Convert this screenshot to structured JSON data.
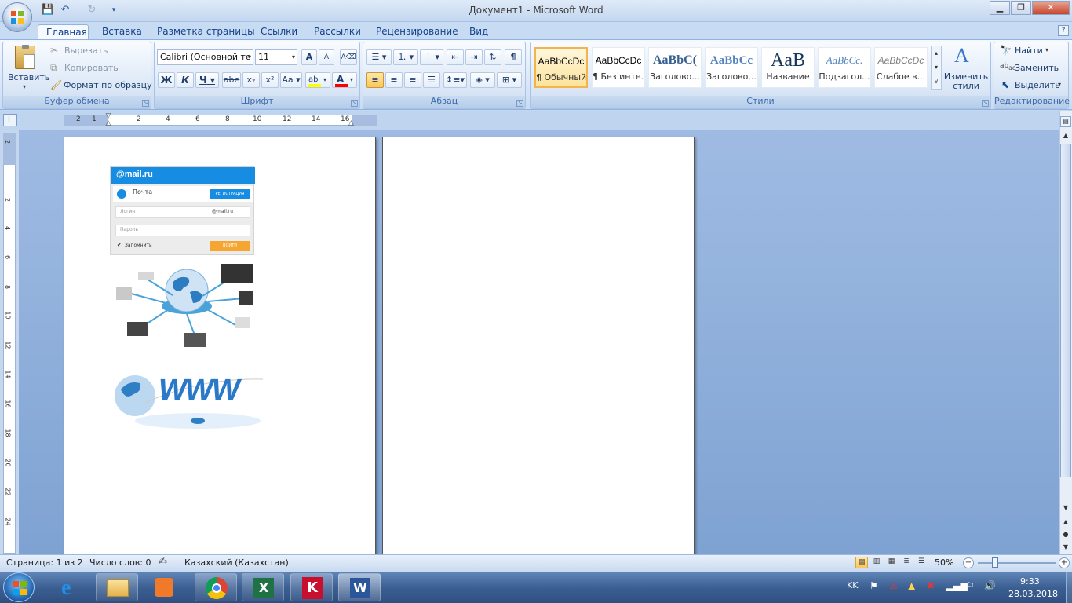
{
  "window": {
    "title": "Документ1 - Microsoft Word"
  },
  "tabs": [
    "Главная",
    "Вставка",
    "Разметка страницы",
    "Ссылки",
    "Рассылки",
    "Рецензирование",
    "Вид"
  ],
  "clipboard": {
    "paste": "Вставить",
    "cut": "Вырезать",
    "copy": "Копировать",
    "format_painter": "Формат по образцу",
    "label": "Буфер обмена"
  },
  "font": {
    "name": "Calibri (Основной те",
    "size": "11",
    "label": "Шрифт",
    "bold": "Ж",
    "italic": "К",
    "underline": "Ч",
    "strike": "abe",
    "subscript": "x₂",
    "superscript": "x²",
    "case": "Aa",
    "grow": "A",
    "shrink": "A"
  },
  "paragraph": {
    "label": "Абзац",
    "pilcrow": "¶"
  },
  "styles": {
    "label": "Стили",
    "items": [
      {
        "preview": "AaBbCcDc",
        "name": "¶ Обычный"
      },
      {
        "preview": "AaBbCcDc",
        "name": "¶ Без инте..."
      },
      {
        "preview": "AaBbC(",
        "name": "Заголово..."
      },
      {
        "preview": "AaBbCc",
        "name": "Заголово..."
      },
      {
        "preview": "AaB",
        "name": "Название"
      },
      {
        "preview": "AaBbCc.",
        "name": "Подзагол..."
      },
      {
        "preview": "AaBbCcDc",
        "name": "Слабое в..."
      }
    ],
    "change": "Изменить стили"
  },
  "editing": {
    "label": "Редактирование",
    "find": "Найти",
    "replace": "Заменить",
    "select": "Выделить"
  },
  "ruler": {
    "h_numbers": [
      "2",
      "1",
      "2",
      "4",
      "6",
      "8",
      "10",
      "12",
      "14",
      "16"
    ],
    "v_numbers": [
      "2",
      "2",
      "4",
      "6",
      "8",
      "10",
      "12",
      "14",
      "16",
      "18",
      "20",
      "22",
      "24"
    ]
  },
  "mailru_widget": {
    "logo": "@mail.ru",
    "title": "Почта",
    "register": "РЕГИСТРАЦИЯ",
    "login_placeholder": "Логин",
    "domain": "@mail.ru",
    "password_placeholder": "Пароль",
    "remember": "Запомнить",
    "submit": "ВОЙТИ"
  },
  "www_image": {
    "text": "WWW"
  },
  "status": {
    "page": "Страница: 1 из 2",
    "words": "Число слов: 0",
    "language": "Казахский (Казахстан)",
    "zoom": "50%"
  },
  "tray": {
    "lang": "KK",
    "time": "9:33",
    "date": "28.03.2018"
  },
  "colors": {
    "ribbon_accent": "#15428b",
    "highlight": "#ffff00",
    "font_color": "#ff0000",
    "style_selected": "#f4b44b"
  }
}
